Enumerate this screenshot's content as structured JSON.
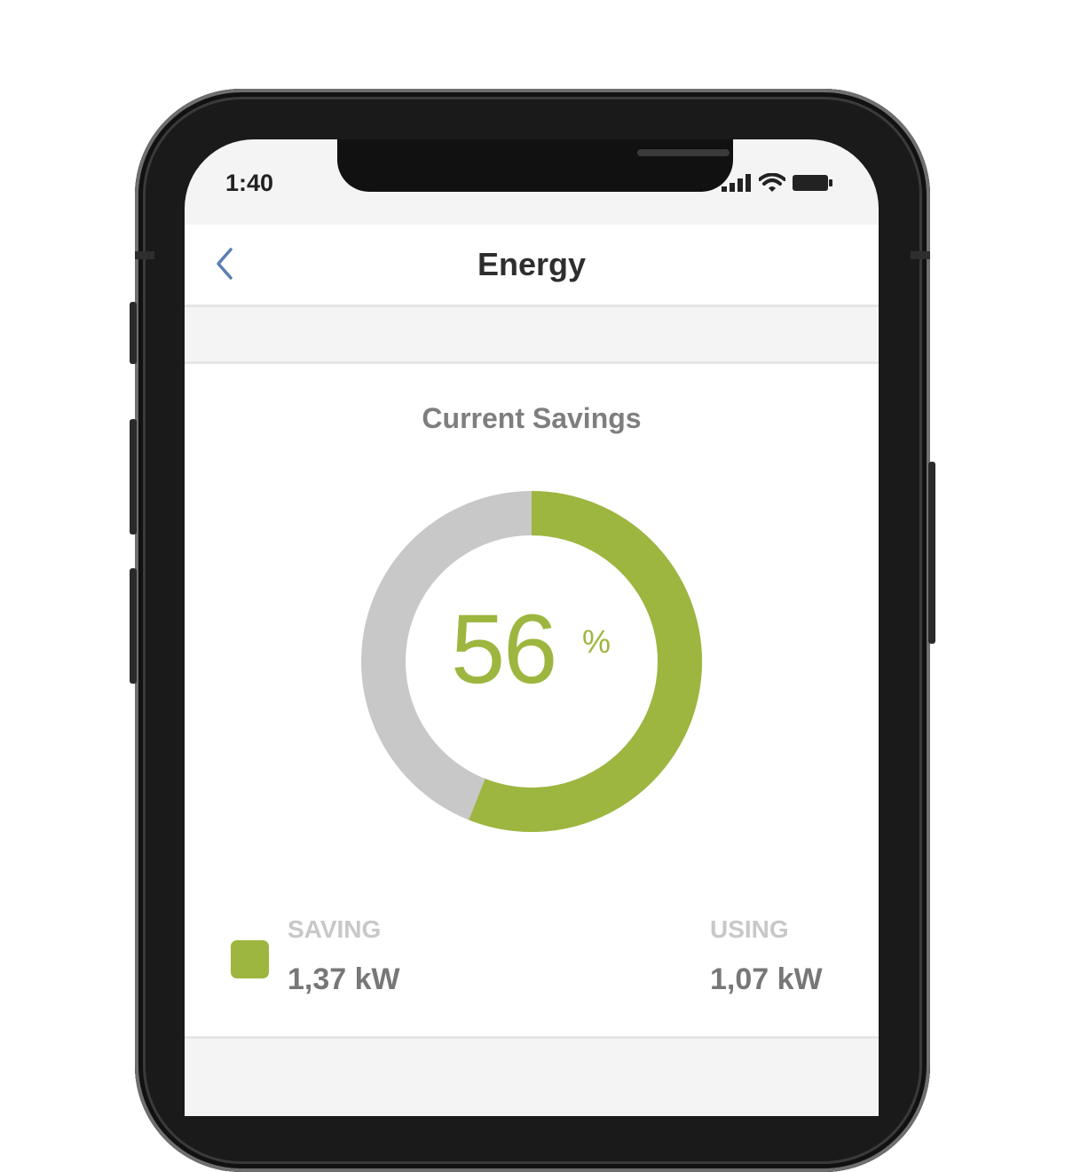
{
  "status_bar": {
    "time": "1:40",
    "icons": [
      "signal-icon",
      "wifi-icon",
      "battery-icon"
    ]
  },
  "navbar": {
    "title": "Energy",
    "back_icon": "chevron-left-icon"
  },
  "savings": {
    "title": "Current Savings",
    "percent": "56",
    "percent_sign": "%",
    "saving_fraction": 0.56,
    "legend": {
      "saving_label": "SAVING",
      "saving_value": "1,37 kW",
      "using_label": "USING",
      "using_value": "1,07 kW"
    }
  },
  "colors": {
    "accent_green": "#9db63f",
    "ring_gray": "#c8c8c8",
    "back_blue": "#5b7fb4"
  }
}
